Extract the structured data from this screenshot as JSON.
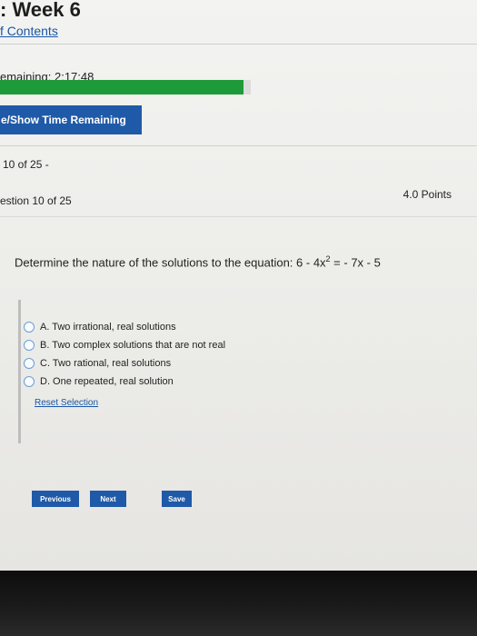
{
  "header": {
    "title": ": Week 6",
    "toc_link": "f Contents"
  },
  "timer": {
    "label": "emaining: 2:17:48",
    "progress_fraction": 0.97,
    "progress_color": "#1d9a3a",
    "toggle_button": "e/Show Time Remaining"
  },
  "question": {
    "counter": "10 of 25 -",
    "heading": "estion 10 of 25",
    "points": "4.0 Points",
    "text_before_exp": "Determine the nature of the solutions to the equation: 6 - 4x",
    "exponent": "2",
    "text_after_exp": " = - 7x - 5",
    "choices": [
      "A. Two irrational, real solutions",
      "B. Two complex solutions that are not real",
      "C. Two rational, real solutions",
      "D. One repeated, real solution"
    ],
    "reset_link": "Reset Selection"
  },
  "nav": {
    "previous": "Previous",
    "next": "Next",
    "save": "Save"
  },
  "colors": {
    "button_blue": "#1f5aa8",
    "link_blue": "#1a57a6"
  }
}
